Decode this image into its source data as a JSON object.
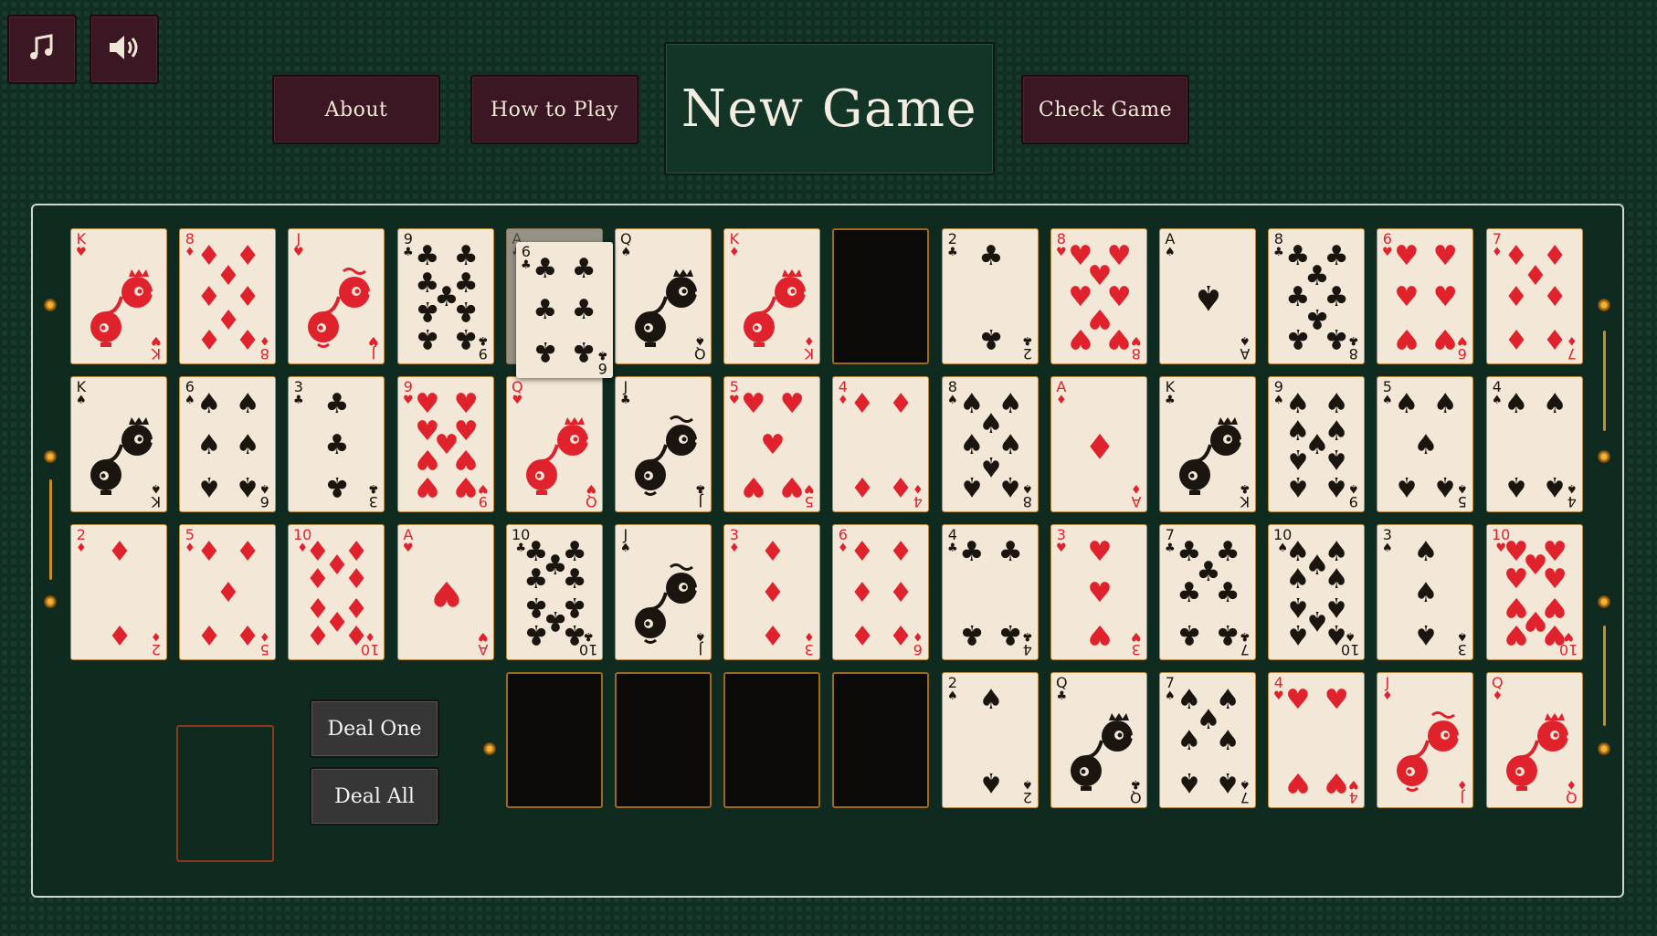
{
  "toolbar": {
    "music_icon": "music-note-icon",
    "sound_icon": "speaker-icon",
    "about_label": "About",
    "how_to_play_label": "How to Play",
    "new_game_label": "New Game",
    "check_game_label": "Check Game"
  },
  "colors": {
    "table_green": "#0f2a1f",
    "button_maroon": "#3a1722",
    "card_face": "#f3e7d8",
    "red_suit": "#e0222c",
    "black_suit": "#1a160f",
    "slot_border": "#9c6a1f"
  },
  "controls": {
    "deal_one_label": "Deal One",
    "deal_all_label": "Deal All"
  },
  "tableau": [
    [
      {
        "rank": "K",
        "suit": "♥"
      },
      {
        "rank": "8",
        "suit": "♦"
      },
      {
        "rank": "J",
        "suit": "♥"
      },
      {
        "rank": "9",
        "suit": "♣"
      },
      {
        "rank": "A",
        "suit": "♣",
        "ghost": true
      },
      {
        "rank": "Q",
        "suit": "♠"
      },
      {
        "rank": "K",
        "suit": "♦"
      },
      {
        "empty": true
      },
      {
        "rank": "2",
        "suit": "♣"
      },
      {
        "rank": "8",
        "suit": "♥"
      },
      {
        "rank": "A",
        "suit": "♠"
      },
      {
        "rank": "8",
        "suit": "♣"
      },
      {
        "rank": "6",
        "suit": "♥"
      },
      {
        "rank": "7",
        "suit": "♦"
      }
    ],
    [
      {
        "rank": "K",
        "suit": "♠"
      },
      {
        "rank": "6",
        "suit": "♠"
      },
      {
        "rank": "3",
        "suit": "♣"
      },
      {
        "rank": "9",
        "suit": "♥"
      },
      {
        "rank": "Q",
        "suit": "♥"
      },
      {
        "rank": "J",
        "suit": "♣"
      },
      {
        "rank": "5",
        "suit": "♥"
      },
      {
        "rank": "4",
        "suit": "♦"
      },
      {
        "rank": "8",
        "suit": "♠"
      },
      {
        "rank": "A",
        "suit": "♦"
      },
      {
        "rank": "K",
        "suit": "♣"
      },
      {
        "rank": "9",
        "suit": "♠"
      },
      {
        "rank": "5",
        "suit": "♠"
      },
      {
        "rank": "4",
        "suit": "♠"
      }
    ],
    [
      {
        "rank": "2",
        "suit": "♦"
      },
      {
        "rank": "5",
        "suit": "♦"
      },
      {
        "rank": "10",
        "suit": "♦"
      },
      {
        "rank": "A",
        "suit": "♥"
      },
      {
        "rank": "10",
        "suit": "♣"
      },
      {
        "rank": "J",
        "suit": "♠"
      },
      {
        "rank": "3",
        "suit": "♦"
      },
      {
        "rank": "6",
        "suit": "♦"
      },
      {
        "rank": "4",
        "suit": "♣"
      },
      {
        "rank": "3",
        "suit": "♥"
      },
      {
        "rank": "7",
        "suit": "♣"
      },
      {
        "rank": "10",
        "suit": "♠"
      },
      {
        "rank": "3",
        "suit": "♠"
      },
      {
        "rank": "10",
        "suit": "♥"
      }
    ],
    [
      null,
      null,
      null,
      null,
      {
        "empty": true
      },
      {
        "empty": true
      },
      {
        "empty": true
      },
      {
        "empty": true
      },
      {
        "rank": "2",
        "suit": "♠"
      },
      {
        "rank": "Q",
        "suit": "♣"
      },
      {
        "rank": "7",
        "suit": "♠"
      },
      {
        "rank": "4",
        "suit": "♥"
      },
      {
        "rank": "J",
        "suit": "♦"
      },
      {
        "rank": "Q",
        "suit": "♦"
      }
    ]
  ],
  "dragging_card": {
    "rank": "6",
    "suit": "♣"
  }
}
